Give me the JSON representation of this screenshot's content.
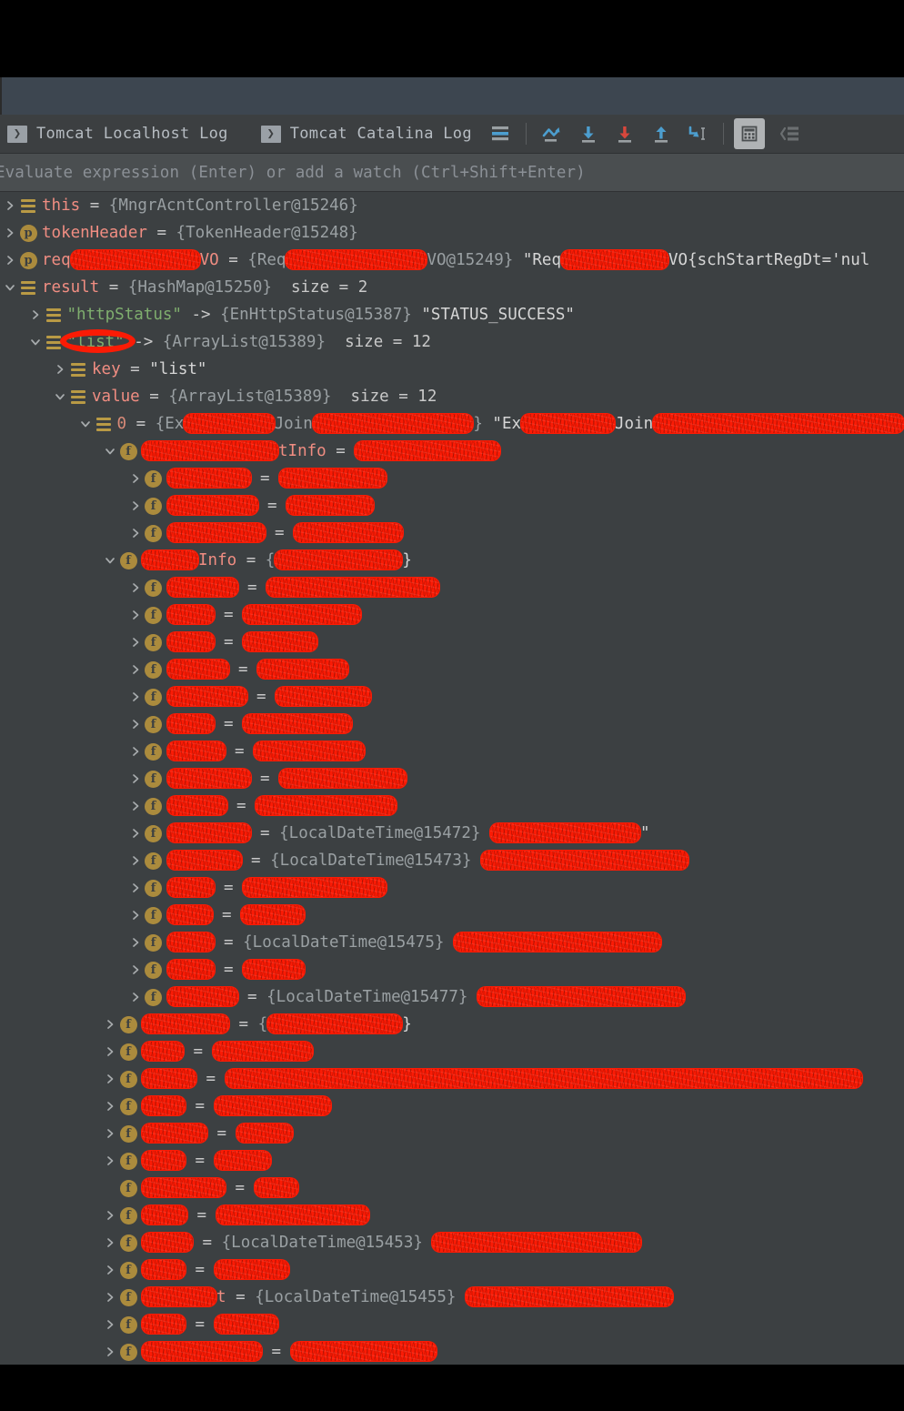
{
  "window": {
    "app": "IntelliJ IDEA Debugger",
    "panel_background": "#3c4042",
    "accent_red": "#fb1b05",
    "accent_blue": "#4c9ecf"
  },
  "console_tabs": [
    {
      "label": "Tomcat Localhost Log",
      "icon": "console-chevron-icon"
    },
    {
      "label": "Tomcat Catalina Log",
      "icon": "console-chevron-icon"
    }
  ],
  "toolbar": {
    "buttons": [
      {
        "name": "show-execution-point-icon",
        "title": "Show Execution Point"
      },
      {
        "name": "step-over-icon",
        "title": "Step Over"
      },
      {
        "name": "step-into-icon",
        "title": "Step Into"
      },
      {
        "name": "force-step-into-icon",
        "title": "Force Step Into"
      },
      {
        "name": "step-out-icon",
        "title": "Step Out"
      },
      {
        "name": "run-to-cursor-icon",
        "title": "Run to Cursor"
      },
      {
        "name": "evaluate-expression-icon",
        "title": "Evaluate Expression",
        "selected": true
      },
      {
        "name": "settings-layout-icon",
        "title": "Layout Settings"
      }
    ]
  },
  "evaluate": {
    "placeholder": "Evaluate expression (Enter) or add a watch (Ctrl+Shift+Enter)",
    "value": ""
  },
  "variables": {
    "rows": [
      {
        "indent": 0,
        "expand": "collapsed",
        "icon": "value",
        "name": "this",
        "op": "=",
        "type": "{MngrAcntController@15246}",
        "extra": ""
      },
      {
        "indent": 0,
        "expand": "collapsed",
        "icon": "param",
        "name": "tokenHeader",
        "op": "=",
        "type": "{TokenHeader@15248}",
        "extra": ""
      },
      {
        "indent": 0,
        "expand": "collapsed",
        "icon": "param",
        "name_prefix": "req",
        "name_redacted": true,
        "name_suffix": "VO",
        "op": "=",
        "type_prefix": "{Req",
        "type_redacted": true,
        "type_suffix": "VO@15249}",
        "tail_prefix": "\"Req",
        "tail_redacted": true,
        "tail_suffix": "VO{schStartRegDt='nul"
      },
      {
        "indent": 0,
        "expand": "expanded",
        "icon": "value",
        "name": "result",
        "op": "=",
        "type": "{HashMap@15250}",
        "extra": "size = 2"
      },
      {
        "indent": 1,
        "expand": "collapsed",
        "icon": "value",
        "key": "\"httpStatus\"",
        "op": "->",
        "type": "{EnHttpStatus@15387}",
        "string": "\"STATUS_SUCCESS\""
      },
      {
        "indent": 1,
        "expand": "expanded",
        "icon": "value",
        "key": "\"list\"",
        "annotated": true,
        "op": "->",
        "type": "{ArrayList@15389}",
        "extra": "size = 12"
      },
      {
        "indent": 2,
        "expand": "collapsed",
        "icon": "value",
        "name": "key",
        "op": "=",
        "string": "\"list\""
      },
      {
        "indent": 2,
        "expand": "expanded",
        "icon": "value",
        "name": "value",
        "op": "=",
        "type": "{ArrayList@15389}",
        "extra": "size = 12"
      },
      {
        "indent": 3,
        "expand": "expanded",
        "icon": "value",
        "index": "0",
        "op": "=",
        "type_prefix": "{Ex",
        "type_redacted": true,
        "type_mid": "Join",
        "type_redacted2": true,
        "type_suffix": "}",
        "tail_prefix": "\"Ex",
        "tail_redacted": true,
        "tail_mid": "Join",
        "tail_redacted2": true
      },
      {
        "indent": 4,
        "expand": "expanded",
        "icon": "field",
        "name_redacted": true,
        "name_suffix": "tInfo",
        "op": "=",
        "value_redacted": true
      },
      {
        "indent": 5,
        "expand": "collapsed",
        "icon": "field",
        "name_redacted": true,
        "op": "=",
        "value_redacted": true
      },
      {
        "indent": 5,
        "expand": "collapsed",
        "icon": "field",
        "name_redacted": true,
        "op": "=",
        "value_redacted": true
      },
      {
        "indent": 5,
        "expand": "collapsed",
        "icon": "field",
        "name_redacted": true,
        "op": "=",
        "value_redacted": true
      },
      {
        "indent": 4,
        "expand": "expanded",
        "icon": "field",
        "name_redacted": true,
        "name_suffix": "Info",
        "op": "=",
        "value_prefix": "{",
        "value_redacted": true,
        "value_suffix": "}"
      },
      {
        "indent": 5,
        "expand": "collapsed",
        "icon": "field",
        "name_redacted": true,
        "op": "=",
        "value_redacted": true
      },
      {
        "indent": 5,
        "expand": "collapsed",
        "icon": "field",
        "name_redacted": true,
        "op": "=",
        "value_redacted": true
      },
      {
        "indent": 5,
        "expand": "collapsed",
        "icon": "field",
        "name_redacted": true,
        "op": "=",
        "value_redacted": true
      },
      {
        "indent": 5,
        "expand": "collapsed",
        "icon": "field",
        "name_redacted": true,
        "op": "=",
        "value_redacted": true
      },
      {
        "indent": 5,
        "expand": "collapsed",
        "icon": "field",
        "name_redacted": true,
        "op": "=",
        "value_redacted": true
      },
      {
        "indent": 5,
        "expand": "collapsed",
        "icon": "field",
        "name_redacted": true,
        "op": "=",
        "value_redacted": true
      },
      {
        "indent": 5,
        "expand": "collapsed",
        "icon": "field",
        "name_redacted": true,
        "op": "=",
        "value_redacted": true
      },
      {
        "indent": 5,
        "expand": "collapsed",
        "icon": "field",
        "name_redacted": true,
        "op": "=",
        "value_redacted": true
      },
      {
        "indent": 5,
        "expand": "collapsed",
        "icon": "field",
        "name_redacted": true,
        "op": "=",
        "value_redacted": true
      },
      {
        "indent": 5,
        "expand": "collapsed",
        "icon": "field",
        "name_redacted": true,
        "op": "=",
        "type": "{LocalDateTime@15472}",
        "value_redacted": true,
        "value_suffix": "\""
      },
      {
        "indent": 5,
        "expand": "collapsed",
        "icon": "field",
        "name_redacted": true,
        "op": "=",
        "type": "{LocalDateTime@15473}",
        "value_redacted": true
      },
      {
        "indent": 5,
        "expand": "collapsed",
        "icon": "field",
        "name_redacted": true,
        "op": "=",
        "value_redacted": true
      },
      {
        "indent": 5,
        "expand": "collapsed",
        "icon": "field",
        "name_redacted": true,
        "op": "=",
        "value_redacted": true
      },
      {
        "indent": 5,
        "expand": "collapsed",
        "icon": "field",
        "name_redacted": true,
        "op": "=",
        "type": "{LocalDateTime@15475}",
        "value_redacted": true
      },
      {
        "indent": 5,
        "expand": "collapsed",
        "icon": "field",
        "name_redacted": true,
        "op": "=",
        "value_redacted": true
      },
      {
        "indent": 5,
        "expand": "collapsed",
        "icon": "field",
        "name_redacted": true,
        "op": "=",
        "type": "{LocalDateTime@15477}",
        "value_redacted": true
      },
      {
        "indent": 4,
        "expand": "collapsed",
        "icon": "field",
        "name_redacted": true,
        "op": "=",
        "value_prefix": "{",
        "value_redacted": true,
        "value_suffix": "}"
      },
      {
        "indent": 4,
        "expand": "collapsed",
        "icon": "field",
        "name_redacted": true,
        "op": "=",
        "value_redacted": true
      },
      {
        "indent": 4,
        "expand": "collapsed",
        "icon": "field",
        "name_redacted": true,
        "op": "=",
        "value_redacted": true
      },
      {
        "indent": 4,
        "expand": "collapsed",
        "icon": "field",
        "name_redacted": true,
        "op": "=",
        "value_redacted": true
      },
      {
        "indent": 4,
        "expand": "collapsed",
        "icon": "field",
        "name_redacted": true,
        "op": "=",
        "value_redacted": true
      },
      {
        "indent": 4,
        "expand": "collapsed",
        "icon": "field",
        "name_redacted": true,
        "op": "=",
        "value_redacted": true
      },
      {
        "indent": 4,
        "expand": "none",
        "icon": "field",
        "name_redacted": true,
        "op": "=",
        "value_redacted": true
      },
      {
        "indent": 4,
        "expand": "collapsed",
        "icon": "field",
        "name_redacted": true,
        "op": "=",
        "value_redacted": true
      },
      {
        "indent": 4,
        "expand": "collapsed",
        "icon": "field",
        "name_redacted": true,
        "op": "=",
        "type": "{LocalDateTime@15453}",
        "value_redacted": true
      },
      {
        "indent": 4,
        "expand": "collapsed",
        "icon": "field",
        "name_redacted": true,
        "op": "=",
        "value_redacted": true
      },
      {
        "indent": 4,
        "expand": "collapsed",
        "icon": "field",
        "name_redacted": true,
        "name_suffix": "t",
        "op": "=",
        "type": "{LocalDateTime@15455}",
        "value_redacted": true
      },
      {
        "indent": 4,
        "expand": "collapsed",
        "icon": "field",
        "name_redacted": true,
        "op": "=",
        "value_redacted": true
      },
      {
        "indent": 4,
        "expand": "collapsed",
        "icon": "field",
        "name_redacted": true,
        "op": "=",
        "value_redacted": true
      },
      {
        "indent": 4,
        "expand": "collapsed",
        "icon": "field",
        "name_redacted": true,
        "op": "=",
        "value_redacted": true
      }
    ]
  }
}
